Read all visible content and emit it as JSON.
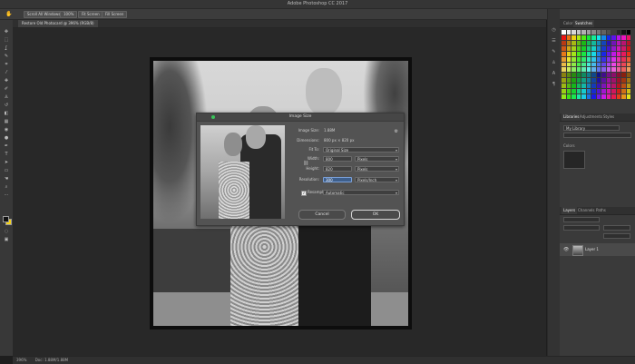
{
  "app": {
    "title": "Adobe Photoshop CC 2017"
  },
  "options_bar": {
    "scroll_all_windows": "Scroll All Windows",
    "zoom": "100%",
    "fit_screen": "Fit Screen",
    "fill_screen": "Fill Screen"
  },
  "document": {
    "tab": "Restore Old Photocard @ 396% (RGB/8)"
  },
  "dialog": {
    "title": "Image Size",
    "image_size_label": "Image Size:",
    "image_size_value": "1.88M",
    "dimensions_label": "Dimensions:",
    "dimensions_value": "800 px × 820 px",
    "fit_to_label": "Fit To:",
    "fit_to_value": "Original Size",
    "width_label": "Width:",
    "width_value": "800",
    "width_unit": "Pixels",
    "height_label": "Height:",
    "height_value": "820",
    "height_unit": "Pixels",
    "resolution_label": "Resolution:",
    "resolution_value": "300",
    "resolution_unit": "Pixels/Inch",
    "resample_label": "Resample:",
    "resample_value": "Automatic",
    "resample_checked": true,
    "cancel": "Cancel",
    "ok": "OK"
  },
  "color_panel": {
    "tab_color": "Color",
    "tab_swatches": "Swatches"
  },
  "libraries_panel": {
    "tab_libraries": "Libraries",
    "tab_adjustments": "Adjustments",
    "tab_styles": "Styles",
    "library_select": "My Library",
    "section_colors": "Colors"
  },
  "layers_panel": {
    "tab_layers": "Layers",
    "tab_channels": "Channels",
    "tab_paths": "Paths",
    "layer_name": "Layer 1"
  },
  "status": {
    "zoom": "396%",
    "doc": "Doc: 1.88M/1.88M"
  },
  "icons": {
    "hand": "✋",
    "gear": "⚙",
    "chain": "⛓",
    "eye": "👁"
  },
  "colors": {
    "accent": "#3e5f8c",
    "foreground": "#111111",
    "background": "#f6d31a"
  }
}
